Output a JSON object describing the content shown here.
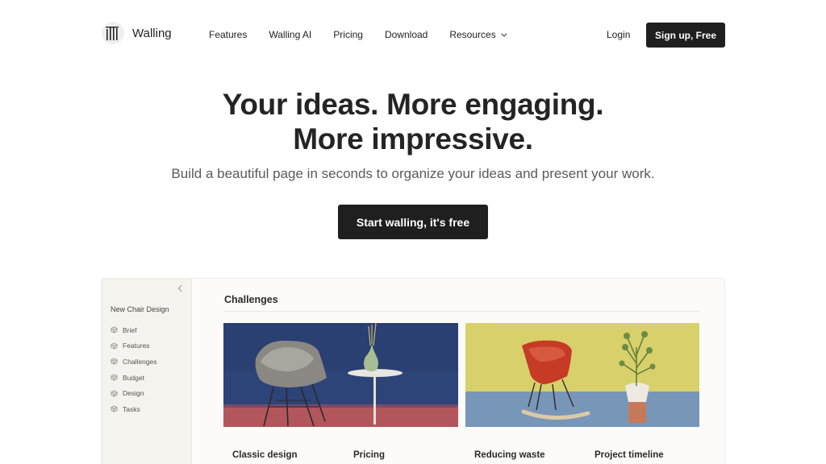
{
  "nav": {
    "logo_text": "Walling",
    "links": [
      "Features",
      "Walling AI",
      "Pricing",
      "Download",
      "Resources"
    ],
    "login_label": "Login",
    "signup_label": "Sign up, Free"
  },
  "hero": {
    "title_line1": "Your ideas. More engaging.",
    "title_line2": "More impressive.",
    "subtitle": "Build a beautiful page in seconds to organize your ideas and present your work.",
    "cta_label": "Start walling, it's free"
  },
  "preview": {
    "doc_title": "New Chair Design",
    "sidebar_items": [
      "Brief",
      "Features",
      "Challenges",
      "Budget",
      "Design",
      "Tasks"
    ],
    "section_title": "Challenges",
    "captions": [
      "Classic design",
      "Pricing",
      "Reducing waste",
      "Project timeline"
    ]
  },
  "colors": {
    "primary_button": "#1f1f1f",
    "sidebar_bg": "#f5f3ee",
    "image1_bg": "#2c4378",
    "image2_bg": "#d7cf6a"
  },
  "icons": [
    "walling-logo-icon",
    "chevron-down-icon",
    "collapse-sidebar-icon",
    "cube-icon"
  ]
}
